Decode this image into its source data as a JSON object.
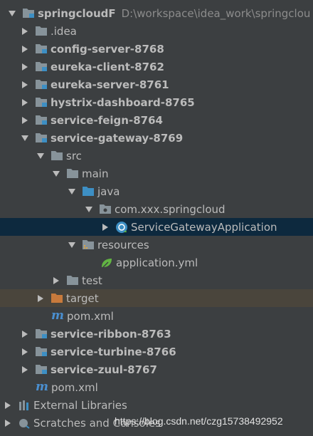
{
  "root": {
    "label": "springcloudF",
    "path": "D:\\workspace\\idea_work\\springclou"
  },
  "items": {
    "idea": ".idea",
    "config_server": "config-server-8768",
    "eureka_client": "eureka-client-8762",
    "eureka_server": "eureka-server-8761",
    "hystrix_dashboard": "hystrix-dashboard-8765",
    "service_feign": "service-feign-8764",
    "service_gateway": "service-gateway-8769",
    "src": "src",
    "main": "main",
    "java": "java",
    "package": "com.xxx.springcloud",
    "app_class": "ServiceGatewayApplication",
    "resources": "resources",
    "application_yml": "application.yml",
    "test": "test",
    "target": "target",
    "gateway_pom": "pom.xml",
    "service_ribbon": "service-ribbon-8763",
    "service_turbine": "service-turbine-8766",
    "service_zuul": "service-zuul-8767",
    "root_pom": "pom.xml",
    "external_libraries": "External Libraries",
    "scratches": "Scratches and Consoles"
  },
  "watermark": "https://blog.csdn.net/czg15738492952",
  "colors": {
    "background": "#3c3f41",
    "selection": "#0d293e",
    "excluded_highlight": "#4a453c",
    "text": "#bbbbbb",
    "folder": "#87939a",
    "source_folder": "#3d8fc4",
    "excluded_folder": "#c87a3c",
    "maven": "#4a8fd0"
  }
}
